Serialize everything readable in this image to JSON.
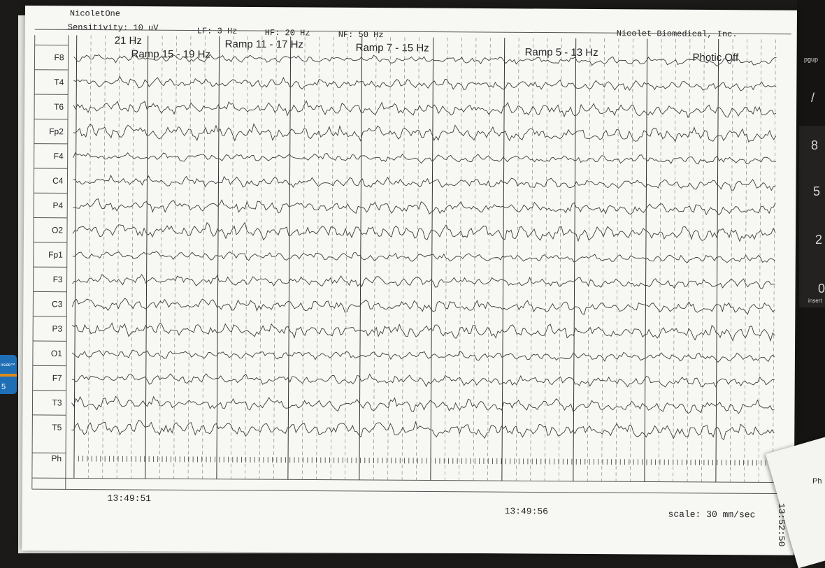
{
  "photo": {
    "app_name": "NicoletOne",
    "settings": {
      "sensitivity": "Sensitivity: 10 uV",
      "lf": "LF: 3 Hz",
      "hf": "HF: 20 Hz",
      "nf": "NF: 50 Hz"
    },
    "company": "Nicolet Biomedical, Inc.",
    "channels": [
      "F8",
      "T4",
      "T6",
      "Fp2",
      "F4",
      "C4",
      "P4",
      "O2",
      "Fp1",
      "F3",
      "C3",
      "P3",
      "O1",
      "F7",
      "T3",
      "T5",
      "Ph"
    ],
    "stimulus_marks": [
      {
        "id": "hz21",
        "label": "21 Hz"
      },
      {
        "id": "ramp15",
        "label": "Ramp 15 - 19 Hz"
      },
      {
        "id": "ramp11",
        "label": "Ramp 11 - 17 Hz"
      },
      {
        "id": "ramp7",
        "label": "Ramp 7 - 15 Hz"
      },
      {
        "id": "ramp5",
        "label": "Ramp 5 - 13 Hz"
      },
      {
        "id": "photic_off",
        "label": "Photic Off"
      }
    ],
    "timestamps": {
      "start": "13:49:51",
      "mid": "13:49:56"
    },
    "scale": "scale: 30 mm/sec",
    "second_sheet": {
      "time": "13:52:50",
      "channel": "Ph"
    },
    "keyboard_keys": [
      "pgup",
      "/",
      "8",
      "5",
      "2",
      "0",
      "insert"
    ],
    "sticker": {
      "text": "nside™",
      "number": "5"
    },
    "colors": {
      "paper": "#f7f7f4",
      "trace": "#3c3c3c",
      "grid_major": "#333333",
      "grid_minor": "#888888",
      "background": "#1c1a18",
      "sticker": "#1f6fb6"
    }
  }
}
